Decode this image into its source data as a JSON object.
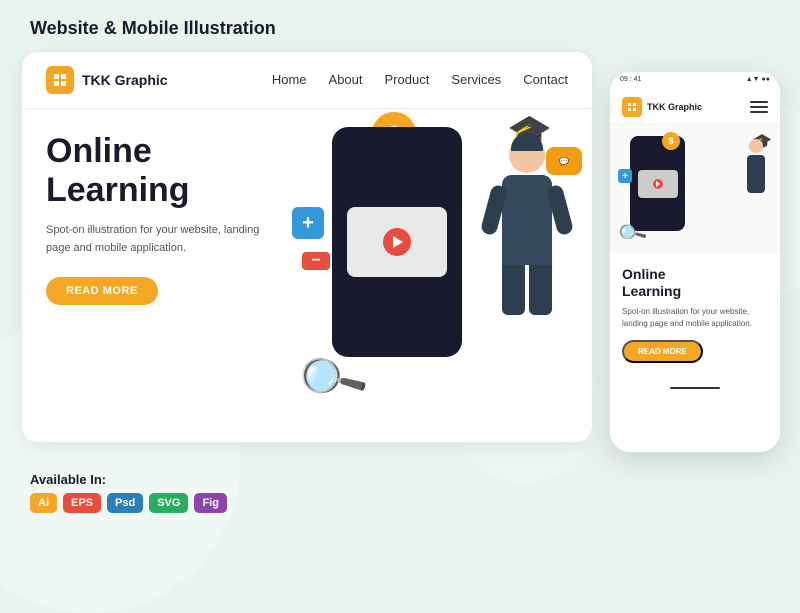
{
  "page": {
    "title": "Website & Mobile Illustration",
    "background_color": "#e8f5ef"
  },
  "navbar": {
    "brand_name": "TKK Graphic",
    "links": [
      "Home",
      "About",
      "Product",
      "Services",
      "Contact"
    ]
  },
  "hero": {
    "title_line1": "Online",
    "title_line2": "Learning",
    "description": "Spot-on illustration for your website, landing page and mobile application.",
    "cta_label": "READ MORE"
  },
  "mobile_hero": {
    "title_line1": "Online",
    "title_line2": "Learning",
    "description": "Spot-on illustration for your website, landing page and mobile application.",
    "cta_label": "READ MORE"
  },
  "available": {
    "label": "Available In:",
    "formats": [
      "Ai",
      "EPS",
      "Psd",
      "SVG",
      "Fig"
    ]
  },
  "icons": {
    "dollar": "$",
    "graduation": "🎓",
    "plus": "+",
    "minus": "−",
    "magnifier": "🔍",
    "hamburger": "☰",
    "chat": "💬"
  },
  "mobile_status": {
    "left": "09 : 41",
    "right": "▲▼ 📶"
  }
}
